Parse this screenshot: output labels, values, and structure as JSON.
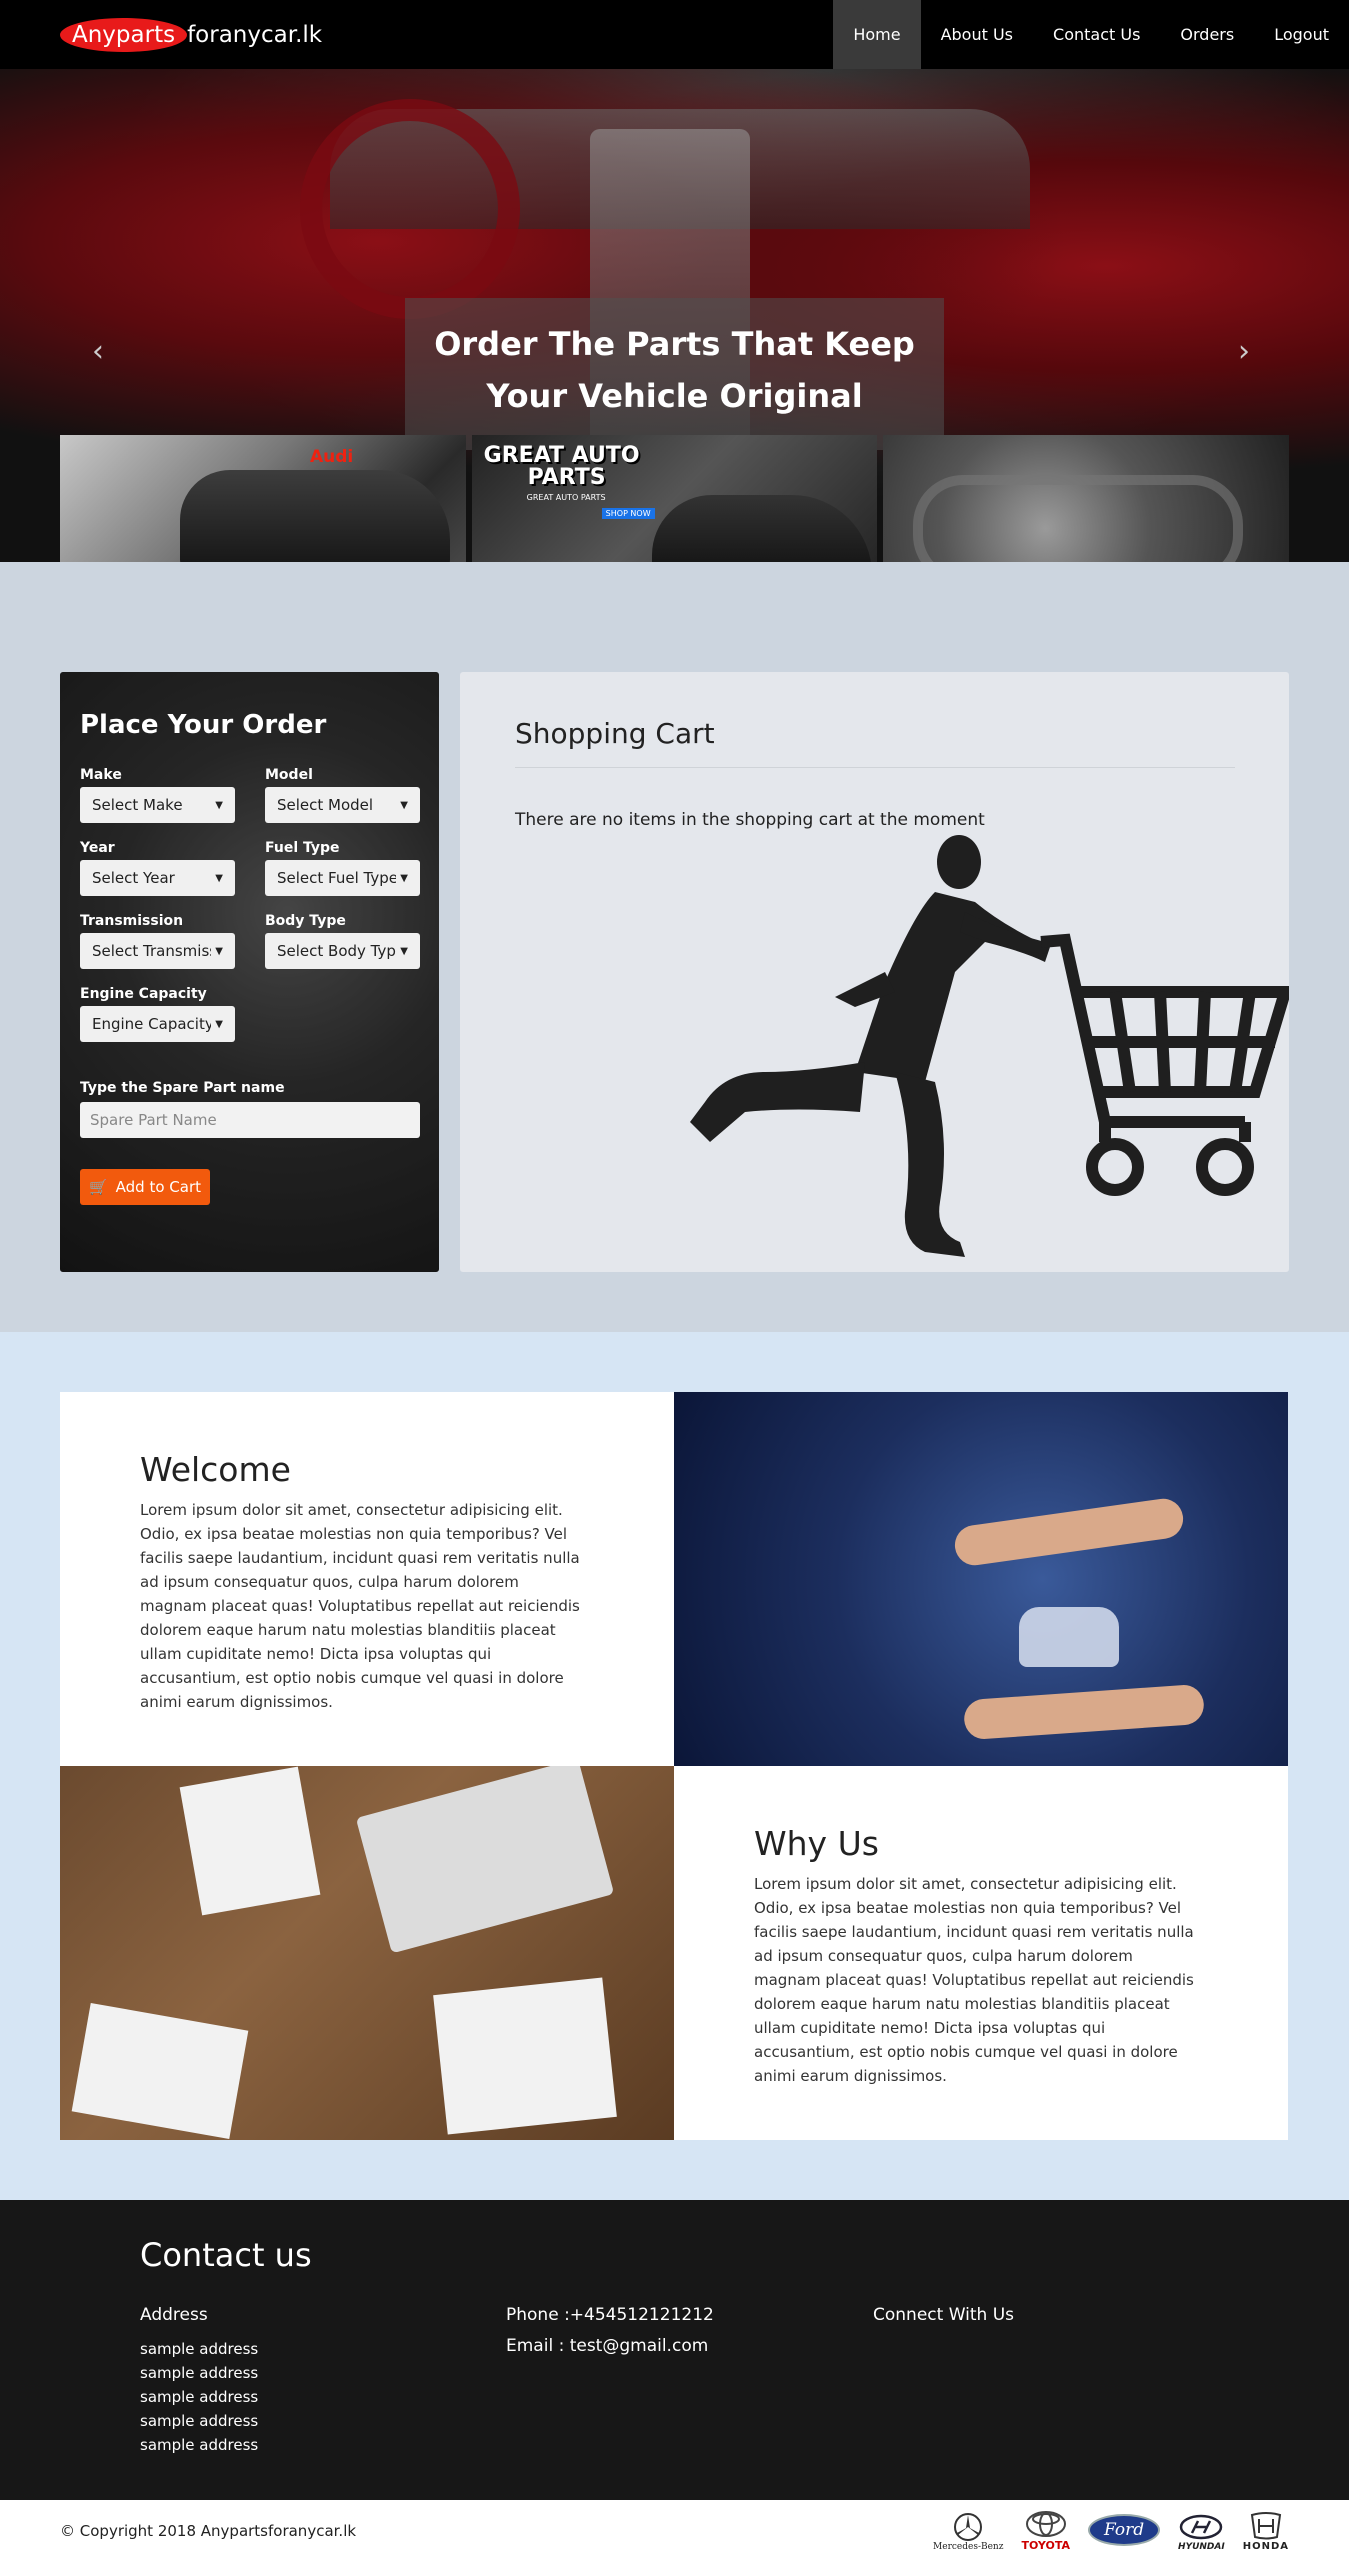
{
  "brand": {
    "highlight": "Anyparts",
    "rest": "foranycar.lk"
  },
  "nav": [
    {
      "label": "Home",
      "active": true
    },
    {
      "label": "About Us"
    },
    {
      "label": "Contact Us"
    },
    {
      "label": "Orders"
    },
    {
      "label": "Logout"
    }
  ],
  "hero": {
    "line1": "Order The Parts That Keep",
    "line2": "Your Vehicle Original",
    "prev_arrow": "‹",
    "next_arrow": "›"
  },
  "promos": {
    "audi_tag": "Audi",
    "great_auto_title_1": "GREAT AUTO",
    "great_auto_title_2": "PARTS",
    "great_auto_sub": "GREAT AUTO PARTS",
    "shop_now": "SHOP NOW"
  },
  "order": {
    "title": "Place Your Order",
    "fields": [
      {
        "label": "Make",
        "value": "Select Make"
      },
      {
        "label": "Model",
        "value": "Select Model"
      },
      {
        "label": "Year",
        "value": "Select Year"
      },
      {
        "label": "Fuel Type",
        "value": "Select Fuel Type"
      },
      {
        "label": "Transmission",
        "value": "Select Transmissi"
      },
      {
        "label": "Body Type",
        "value": "Select Body Type"
      },
      {
        "label": "Engine Capacity",
        "value": "Engine Capacity"
      }
    ],
    "spare_label": "Type the Spare Part name",
    "spare_placeholder": "Spare Part Name",
    "add_button": "Add to Cart"
  },
  "cart": {
    "title": "Shopping Cart",
    "empty_message": "There are no items in the shopping cart at the moment"
  },
  "welcome": {
    "title": "Welcome",
    "body": "Lorem ipsum dolor sit amet, consectetur adipisicing elit. Odio, ex ipsa beatae molestias non quia temporibus? Vel facilis saepe laudantium, incidunt quasi rem veritatis nulla ad ipsum consequatur quos, culpa harum dolorem magnam placeat quas! Voluptatibus repellat aut reiciendis dolorem eaque harum natu molestias blanditiis placeat ullam cupiditate nemo! Dicta ipsa voluptas qui accusantium, est optio nobis cumque vel quasi in dolore animi earum dignissimos."
  },
  "why": {
    "title": "Why Us",
    "body": "Lorem ipsum dolor sit amet, consectetur adipisicing elit. Odio, ex ipsa beatae molestias non quia temporibus? Vel facilis saepe laudantium, incidunt quasi rem veritatis nulla ad ipsum consequatur quos, culpa harum dolorem magnam placeat quas! Voluptatibus repellat aut reiciendis dolorem eaque harum natu molestias blanditiis placeat ullam cupiditate nemo! Dicta ipsa voluptas qui accusantium, est optio nobis cumque vel quasi in dolore animi earum dignissimos."
  },
  "contact": {
    "title": "Contact us",
    "address_title": "Address",
    "addresses": [
      "sample address",
      "sample address",
      "sample address",
      "sample address",
      "sample address"
    ],
    "phone": "Phone :+454512121212",
    "email": "Email : test@gmail.com",
    "connect_title": "Connect With Us"
  },
  "footer": {
    "copyright": "© Copyright 2018 Anypartsforanycar.lk",
    "brands": [
      "Mercedes-Benz",
      "TOYOTA",
      "Ford",
      "HYUNDAI",
      "HONDA"
    ]
  },
  "colors": {
    "brand_red": "#e81a1a",
    "accent_orange": "#f25a0d",
    "order_bg": "#ccd5df",
    "features_bg": "#d6e5f4",
    "dark": "#171717"
  }
}
